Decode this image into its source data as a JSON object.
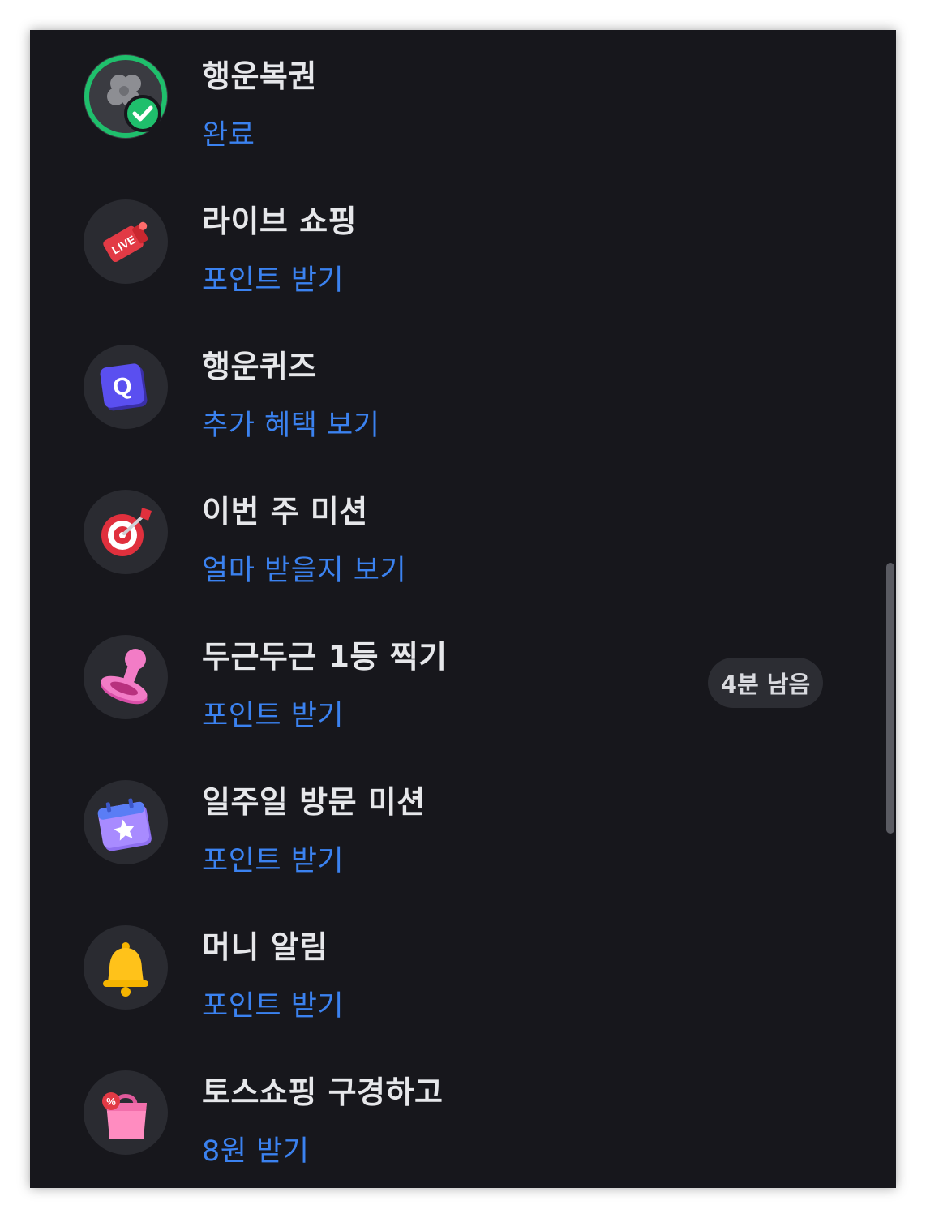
{
  "items": [
    {
      "title": "행운복권",
      "action": "완료",
      "icon": "clover-check-icon",
      "status": "done"
    },
    {
      "title": "라이브 쇼핑",
      "action": "포인트 받기",
      "icon": "live-tag-icon",
      "icon_text": "LIVE"
    },
    {
      "title": "행운퀴즈",
      "action": "추가 혜택 보기",
      "icon": "quiz-q-icon",
      "icon_text": "Q"
    },
    {
      "title": "이번 주 미션",
      "action": "얼마 받을지 보기",
      "icon": "target-icon"
    },
    {
      "title": "두근두근 1등 찍기",
      "action": "포인트 받기",
      "icon": "stamp-icon",
      "badge": "4분 남음"
    },
    {
      "title": "일주일 방문 미션",
      "action": "포인트 받기",
      "icon": "calendar-star-icon"
    },
    {
      "title": "머니 알림",
      "action": "포인트 받기",
      "icon": "bell-icon"
    },
    {
      "title": "토스쇼핑 구경하고",
      "action": "8원 받기",
      "icon": "shopping-bag-icon",
      "icon_text": "%"
    }
  ],
  "colors": {
    "background": "#17171c",
    "title": "#e6e7ea",
    "action": "#3b82f0",
    "complete_ring": "#1fbf6c",
    "icon_circle": "#2a2b31"
  }
}
